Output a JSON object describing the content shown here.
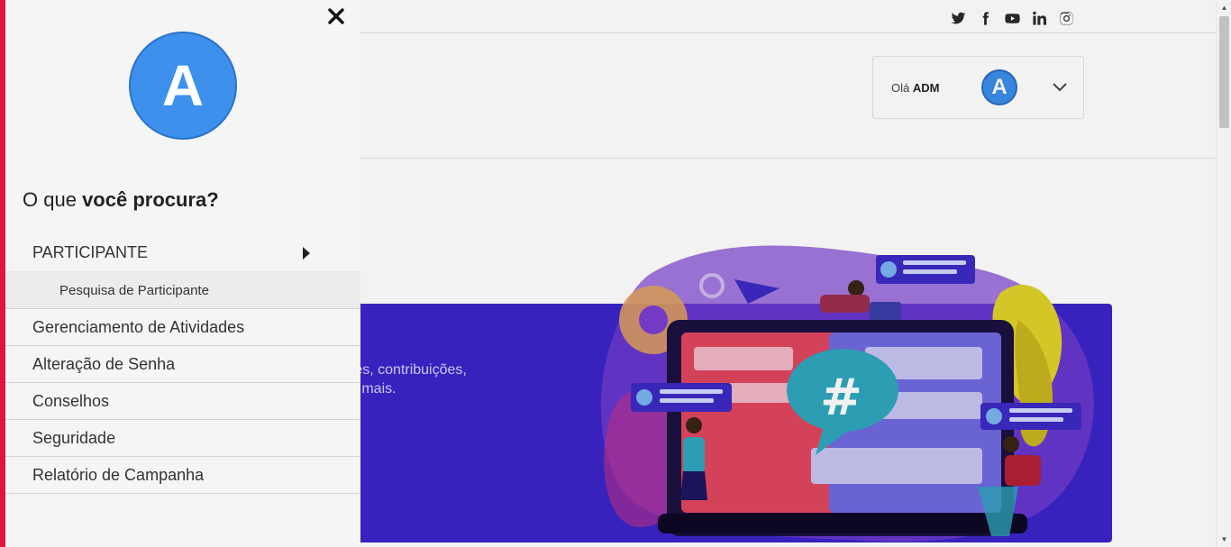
{
  "header": {
    "social_icons": [
      "twitter-icon",
      "facebook-icon",
      "youtube-icon",
      "linkedin-icon",
      "instagram-icon"
    ],
    "greeting_prefix": "Olá",
    "user_name": "ADM",
    "user_initial": "A"
  },
  "banner": {
    "text_line1": "ntes, contribuições,",
    "text_line2": "ito mais.",
    "hashtag": "#"
  },
  "drawer": {
    "avatar_initial": "A",
    "title_prefix": "O que",
    "title_bold": "você procura?",
    "menu": [
      {
        "label": "PARTICIPANTE",
        "expanded": true
      },
      {
        "label": "Pesquisa de Participante",
        "submenu": true
      },
      {
        "label": "Gerenciamento de Atividades"
      },
      {
        "label": "Alteração de Senha"
      },
      {
        "label": "Conselhos"
      },
      {
        "label": "Seguridade"
      },
      {
        "label": "Relatório de Campanha"
      }
    ]
  },
  "colors": {
    "accent_red": "#e0163c",
    "avatar_blue": "#3d90ec",
    "banner_purple": "#3a24c9",
    "drawer_bg": "#f5f5f5"
  }
}
